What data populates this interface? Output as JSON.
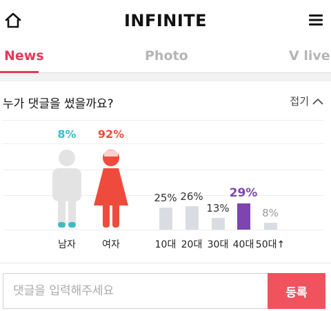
{
  "header": {
    "title": "INFINITE",
    "home_icon": "home-icon",
    "menu_icon": "hamburger-menu-icon"
  },
  "tabs": [
    {
      "label": "News",
      "active": true
    },
    {
      "label": "Photo",
      "active": false
    },
    {
      "label": "V live",
      "active": false
    }
  ],
  "comment_stats": {
    "question": "누가 댓글을 썼을까요?",
    "collapse_label": "접기",
    "collapse_icon": "chevron-up-icon",
    "gender": [
      {
        "label": "남자",
        "percent_label": "8%",
        "value": 8,
        "color": "#3bbcc5"
      },
      {
        "label": "여자",
        "percent_label": "92%",
        "value": 92,
        "color": "#ef4b3c"
      }
    ]
  },
  "chart_data": {
    "type": "bar",
    "categories": [
      "10대",
      "20대",
      "30대",
      "40대",
      "50대↑"
    ],
    "values": [
      25,
      26,
      13,
      29,
      8
    ],
    "value_labels": [
      "25%",
      "26%",
      "13%",
      "29%",
      "8%"
    ],
    "highlight_index": 3,
    "highlight_color": "#7e44b0",
    "bar_color": "#d9dde2",
    "ylim": [
      0,
      100
    ]
  },
  "comment_form": {
    "placeholder": "댓글을 입력해주세요",
    "value": "",
    "submit_label": "등록"
  }
}
